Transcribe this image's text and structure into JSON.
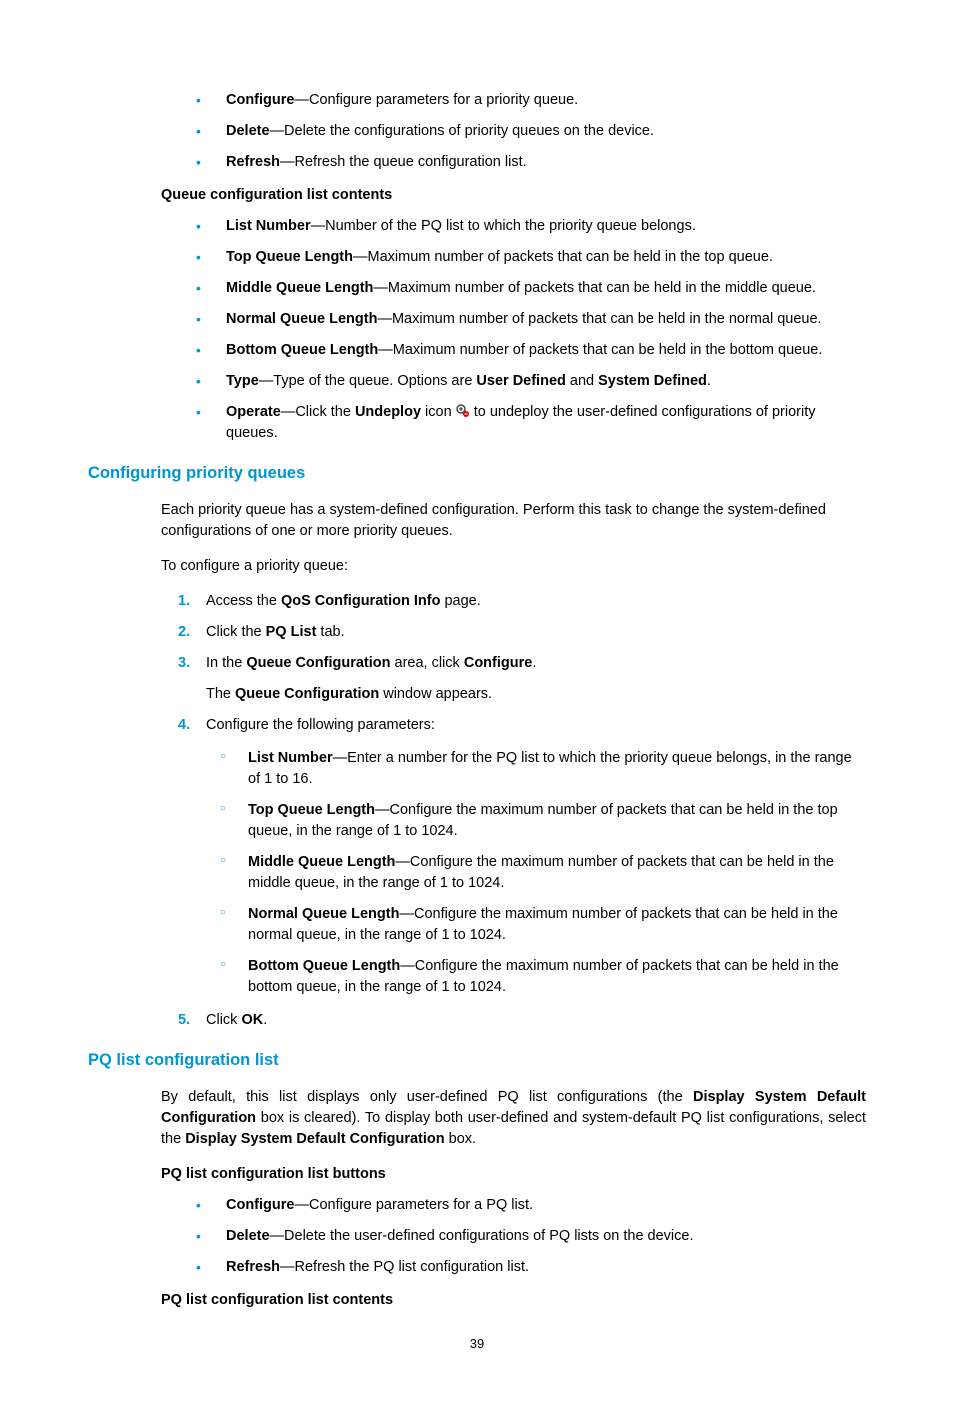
{
  "topButtons": [
    {
      "name": "Configure",
      "desc": "—Configure parameters for a priority queue."
    },
    {
      "name": "Delete",
      "desc": "—Delete the configurations of priority queues on the device."
    },
    {
      "name": "Refresh",
      "desc": "—Refresh the queue configuration list."
    }
  ],
  "queueContentsHeading": "Queue configuration list contents",
  "queueContents": [
    {
      "name": "List Number",
      "desc": "—Number of the PQ list to which the priority queue belongs."
    },
    {
      "name": "Top Queue Length",
      "desc": "—Maximum number of packets that can be held in the top queue."
    },
    {
      "name": "Middle Queue Length",
      "desc": "—Maximum number of packets that can be held in the middle queue."
    },
    {
      "name": "Normal Queue Length",
      "desc": "—Maximum number of packets that can be held in the normal queue."
    },
    {
      "name": "Bottom Queue Length",
      "desc": "—Maximum number of packets that can be held in the bottom queue."
    }
  ],
  "typeItem": {
    "name": "Type",
    "pre": "—Type of the queue. Options are ",
    "opt1": "User Defined",
    "mid": " and ",
    "opt2": "System Defined",
    "end": "."
  },
  "operateItem": {
    "name": "Operate",
    "pre": "—Click the ",
    "undeploy": "Undeploy",
    "mid": " icon ",
    "post": " to undeploy the user-defined configurations of priority queues."
  },
  "section1": "Configuring priority queues",
  "section1Intro": "Each priority queue has a system-defined configuration. Perform this task to change the system-defined configurations of one or more priority queues.",
  "section1Lead": "To configure a priority queue:",
  "step1": {
    "pre": "Access the ",
    "bold": "QoS Configuration Info",
    "post": " page."
  },
  "step2": {
    "pre": "Click the ",
    "bold": "PQ List",
    "post": " tab."
  },
  "step3": {
    "pre": "In the ",
    "b1": "Queue Configuration",
    "mid": " area, click ",
    "b2": "Configure",
    "end": "."
  },
  "step3b": {
    "pre": "The ",
    "bold": "Queue Configuration",
    "post": " window appears."
  },
  "step4": "Configure the following parameters:",
  "step4Subs": [
    {
      "name": "List Number",
      "desc": "—Enter a number for the PQ list to which the priority queue belongs, in the range of 1 to 16."
    },
    {
      "name": "Top Queue Length",
      "desc": "—Configure the maximum number of packets that can be held in the top queue, in the range of 1 to 1024."
    },
    {
      "name": "Middle Queue Length",
      "desc": "—Configure the maximum number of packets that can be held in the middle queue, in the range of 1 to 1024."
    },
    {
      "name": "Normal Queue Length",
      "desc": "—Configure the maximum number of packets that can be held in the normal queue, in the range of 1 to 1024."
    },
    {
      "name": "Bottom Queue Length",
      "desc": "—Configure the maximum number of packets that can be held in the bottom queue, in the range of 1 to 1024."
    }
  ],
  "step5": {
    "pre": "Click ",
    "bold": "OK",
    "post": "."
  },
  "section2": "PQ list configuration list",
  "section2Intro": {
    "p1": "By default, this list displays only user-defined PQ list configurations (the ",
    "b1": "Display System Default Configuration",
    "p2": " box is cleared). To display both user-defined and system-default PQ list configurations, select the ",
    "b2": "Display System Default Configuration",
    "p3": " box."
  },
  "pqButtonsHeading": "PQ list configuration list buttons",
  "pqButtons": [
    {
      "name": "Configure",
      "desc": "—Configure parameters for a PQ list."
    },
    {
      "name": "Delete",
      "desc": "—Delete the user-defined configurations of PQ lists on the device."
    },
    {
      "name": "Refresh",
      "desc": "—Refresh the PQ list configuration list."
    }
  ],
  "pqContentsHeading": "PQ list configuration list contents",
  "pageNumber": "39"
}
